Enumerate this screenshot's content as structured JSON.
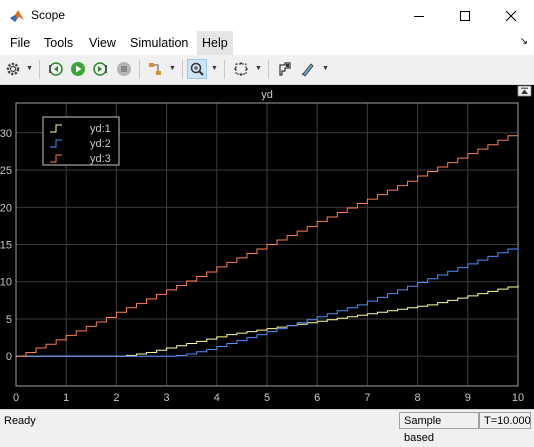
{
  "window": {
    "title": "Scope"
  },
  "menu": [
    "File",
    "Tools",
    "View",
    "Simulation",
    "Help"
  ],
  "toolbar": {
    "icons": [
      "gear-icon",
      "step-back-icon",
      "run-icon",
      "step-forward-icon",
      "stop-icon",
      "highlight-icon",
      "zoom-icon",
      "fit-to-view-icon",
      "cursor-measurement-icon",
      "style-icon"
    ]
  },
  "chart_data": {
    "type": "line",
    "title": "yd",
    "xlim": [
      0,
      10
    ],
    "ylim": [
      -4,
      34
    ],
    "xticks": [
      "0",
      "1",
      "2",
      "3",
      "4",
      "5",
      "6",
      "7",
      "8",
      "9",
      "10"
    ],
    "yticks": [
      "0",
      "5",
      "10",
      "15",
      "20",
      "25",
      "30"
    ],
    "grid": true,
    "legend_position": "top-left",
    "background": "#000000",
    "series": [
      {
        "name": "yd:1",
        "color": "#ffff99",
        "values": [
          0,
          0,
          0,
          0,
          0,
          0,
          0,
          0,
          0,
          0,
          0,
          0.11,
          0.3,
          0.5,
          0.8,
          1.1,
          1.4,
          1.7,
          2.0,
          2.3,
          2.6,
          2.9,
          3.1,
          3.3,
          3.5,
          3.7,
          3.9,
          4.1,
          4.3,
          4.5,
          4.7,
          4.9,
          5.1,
          5.3,
          5.5,
          5.7,
          5.9,
          6.1,
          6.3,
          6.5,
          6.7,
          6.9,
          7.2,
          7.5,
          7.8,
          8.1,
          8.4,
          8.7,
          9.0,
          9.3,
          9.6
        ]
      },
      {
        "name": "yd:2",
        "color": "#4d8fff",
        "values": [
          0,
          0,
          0,
          0,
          0,
          0,
          0,
          0,
          0,
          0,
          0,
          0,
          0,
          0,
          0,
          0,
          0.1,
          0.3,
          0.6,
          0.9,
          1.3,
          1.7,
          2.1,
          2.5,
          2.9,
          3.3,
          3.7,
          4.1,
          4.5,
          4.9,
          5.3,
          5.7,
          6.1,
          6.5,
          6.9,
          7.4,
          7.9,
          8.4,
          8.9,
          9.4,
          9.9,
          10.4,
          10.9,
          11.4,
          11.9,
          12.4,
          12.9,
          13.4,
          13.9,
          14.4,
          13.7
        ]
      },
      {
        "name": "yd:3",
        "color": "#ff7f50",
        "values": [
          0,
          0.5,
          1.1,
          1.6,
          2.2,
          2.8,
          3.4,
          4.0,
          4.6,
          5.2,
          5.9,
          6.5,
          7.1,
          7.7,
          8.3,
          8.9,
          9.5,
          10.1,
          10.7,
          11.3,
          12.0,
          12.6,
          13.2,
          13.8,
          14.4,
          15.0,
          15.6,
          16.2,
          16.8,
          17.4,
          18.1,
          18.7,
          19.3,
          19.9,
          20.5,
          21.1,
          21.7,
          22.3,
          22.9,
          23.5,
          24.2,
          24.8,
          25.4,
          26.0,
          26.6,
          27.2,
          27.8,
          28.4,
          29.0,
          29.6,
          29.6
        ]
      }
    ]
  },
  "status": {
    "ready": "Ready",
    "sample": "Sample based",
    "time": "T=10.000"
  }
}
